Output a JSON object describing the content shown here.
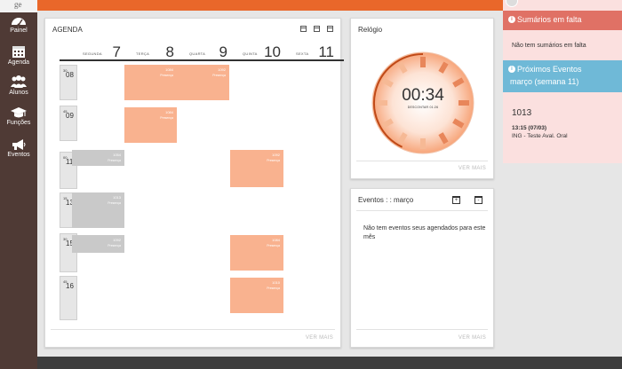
{
  "logo": {
    "text": "ge"
  },
  "nav": {
    "items": [
      {
        "label": "Painel"
      },
      {
        "label": "Agenda"
      },
      {
        "label": "Alunos"
      },
      {
        "label": "Funções"
      },
      {
        "label": "Eventos"
      }
    ]
  },
  "agenda": {
    "title": "AGENDA",
    "days": [
      {
        "name": "SEGUNDA",
        "num": "7"
      },
      {
        "name": "TERÇA",
        "num": "8"
      },
      {
        "name": "QUARTA",
        "num": "9"
      },
      {
        "name": "QUINTA",
        "num": "10"
      },
      {
        "name": "SEXTA",
        "num": "11"
      }
    ],
    "hours": [
      {
        "h": "08",
        "m": "30"
      },
      {
        "h": "09",
        "m": "45"
      },
      {
        "h": "11",
        "m": "00"
      },
      {
        "h": "13",
        "m": "15"
      },
      {
        "h": "15",
        "m": "30"
      },
      {
        "h": "16",
        "m": "45"
      }
    ],
    "events": [
      {
        "code": "1084",
        "type": "Presença"
      },
      {
        "code": "1092",
        "type": "Presença"
      },
      {
        "code": "1084",
        "type": "Presença"
      },
      {
        "code": "1054",
        "type": "Presença"
      },
      {
        "code": "1092",
        "type": "Presença"
      },
      {
        "code": "1013",
        "type": "Presença"
      },
      {
        "code": "1092",
        "type": "Presença"
      },
      {
        "code": "1084",
        "type": "Presença"
      },
      {
        "code": "1010",
        "type": "Presença"
      }
    ],
    "ver_mais": "VER MAIS"
  },
  "relogio": {
    "title": "Relógio",
    "time": "00:34",
    "subtitle": "DESCONTAR 01:26",
    "progress": 0.43,
    "ver_mais": "VER MAIS"
  },
  "eventos": {
    "title": "Eventos : : março",
    "empty": "Não tem eventos seus agendados para este mês",
    "ver_mais": "VER MAIS"
  },
  "right": {
    "sumarios_title": "Sumários em falta",
    "sumarios_empty": "Não tem sumários em falta",
    "proximos_title_1": "Próximos Eventos",
    "proximos_title_2": "março (semana 11)",
    "event_code": "1013",
    "event_when": "13:15 (07/03)",
    "event_desc": "ING - Teste Aval. Oral"
  },
  "colors": {
    "accent": "#e9672a",
    "sidebar": "#4f3a35",
    "event_orange": "#f9b28f",
    "event_gray": "#c9c9c9",
    "sumarios_head": "#e07165",
    "proximos_head": "#6fb9d7"
  }
}
